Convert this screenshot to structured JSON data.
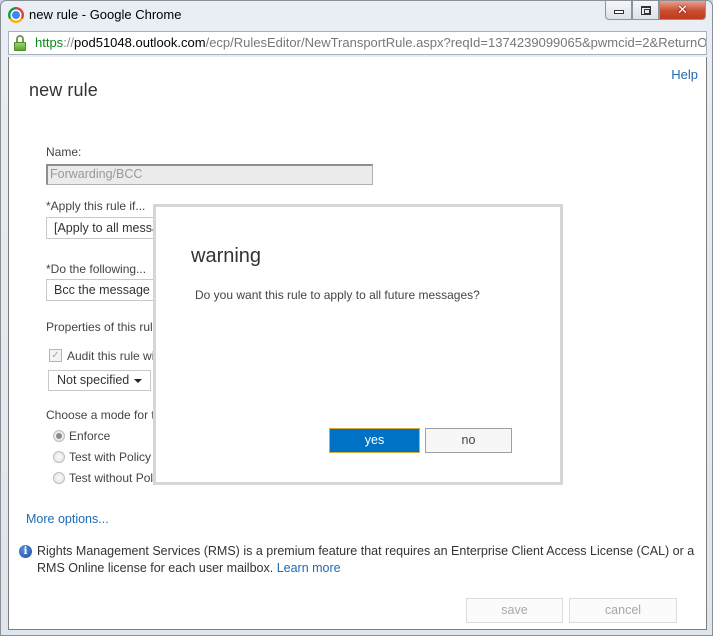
{
  "window": {
    "title": "new rule - Google Chrome",
    "controls": {
      "minimize": "minimize",
      "maximize": "maximize",
      "close": "✕"
    }
  },
  "addressbar": {
    "scheme": "https",
    "separator": "://",
    "host": "pod51048.outlook.com",
    "path": "/ecp/RulesEditor/NewTransportRule.aspx?reqId=1374239099065&pwmcid=2&ReturnObjectType"
  },
  "page": {
    "help_label": "Help",
    "title": "new rule",
    "name_label": "Name:",
    "name_value": "Forwarding/BCC",
    "apply_if_label": "*Apply this rule if...",
    "apply_if_value": "[Apply to all messages]",
    "do_following_label": "*Do the following...",
    "do_following_value": "Bcc the message to...",
    "properties_label": "Properties of this rule:",
    "audit_label": "Audit this rule with severity level:",
    "audit_checked": true,
    "severity_value": "Not specified",
    "mode_label": "Choose a mode for this rule:",
    "modes": [
      {
        "label": "Enforce",
        "checked": true
      },
      {
        "label": "Test with Policy Tips",
        "checked": false
      },
      {
        "label": "Test without Policy Tips",
        "checked": false
      }
    ],
    "more_options": "More options...",
    "info_text": "Rights Management Services (RMS) is a premium feature that requires an Enterprise Client Access License (CAL) or a RMS Online license for each user mailbox.",
    "learn_more": "Learn more",
    "save_label": "save",
    "cancel_label": "cancel"
  },
  "dialog": {
    "title": "warning",
    "message": "Do you want this rule to apply to all future messages?",
    "yes_label": "yes",
    "no_label": "no"
  }
}
